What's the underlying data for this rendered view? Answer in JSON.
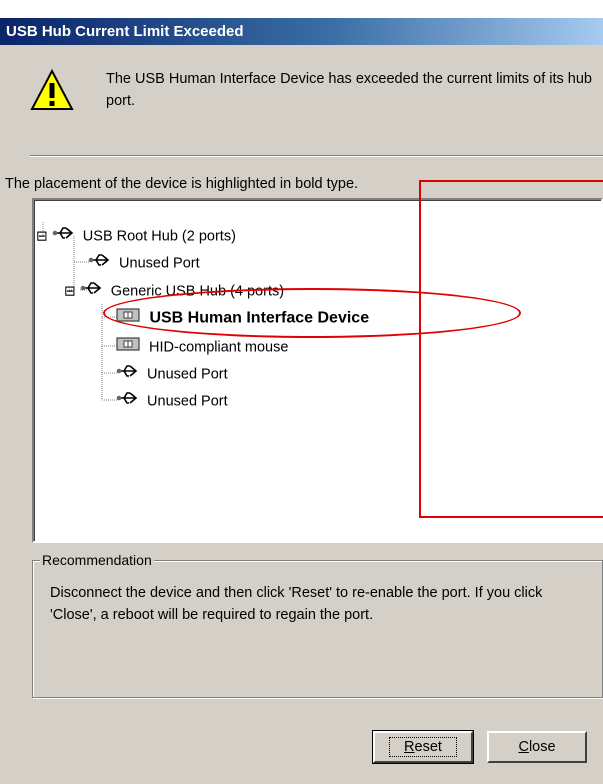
{
  "window": {
    "title": "USB Hub Current Limit Exceeded"
  },
  "message": "The USB Human Interface Device has exceeded the current limits of its hub port.",
  "placement_text": "The placement of the device is highlighted in bold type.",
  "tree": {
    "root": {
      "label": "USB Root Hub (2 ports)",
      "icon": "usb-icon",
      "expander": "⊟"
    },
    "unused1": {
      "label": "Unused Port",
      "icon": "usb-icon"
    },
    "hub": {
      "label": "Generic USB Hub (4 ports)",
      "icon": "usb-icon",
      "expander": "⊟"
    },
    "hid": {
      "label": "USB Human Interface Device",
      "icon": "hid-device-icon"
    },
    "mouse": {
      "label": "HID-compliant mouse",
      "icon": "hid-device-icon"
    },
    "unused2": {
      "label": "Unused Port",
      "icon": "usb-icon"
    },
    "unused3": {
      "label": "Unused Port",
      "icon": "usb-icon"
    }
  },
  "recommendation": {
    "legend": "Recommendation",
    "text": "Disconnect the device and then click 'Reset' to re-enable the port. If you click 'Close', a reboot will be required to regain the port."
  },
  "buttons": {
    "reset": {
      "accel": "R",
      "rest": "eset"
    },
    "close": {
      "accel": "C",
      "rest": "lose"
    }
  },
  "colors": {
    "callout": "#e00000",
    "titlebar_start": "#0a246a",
    "titlebar_end": "#a6caf0"
  }
}
